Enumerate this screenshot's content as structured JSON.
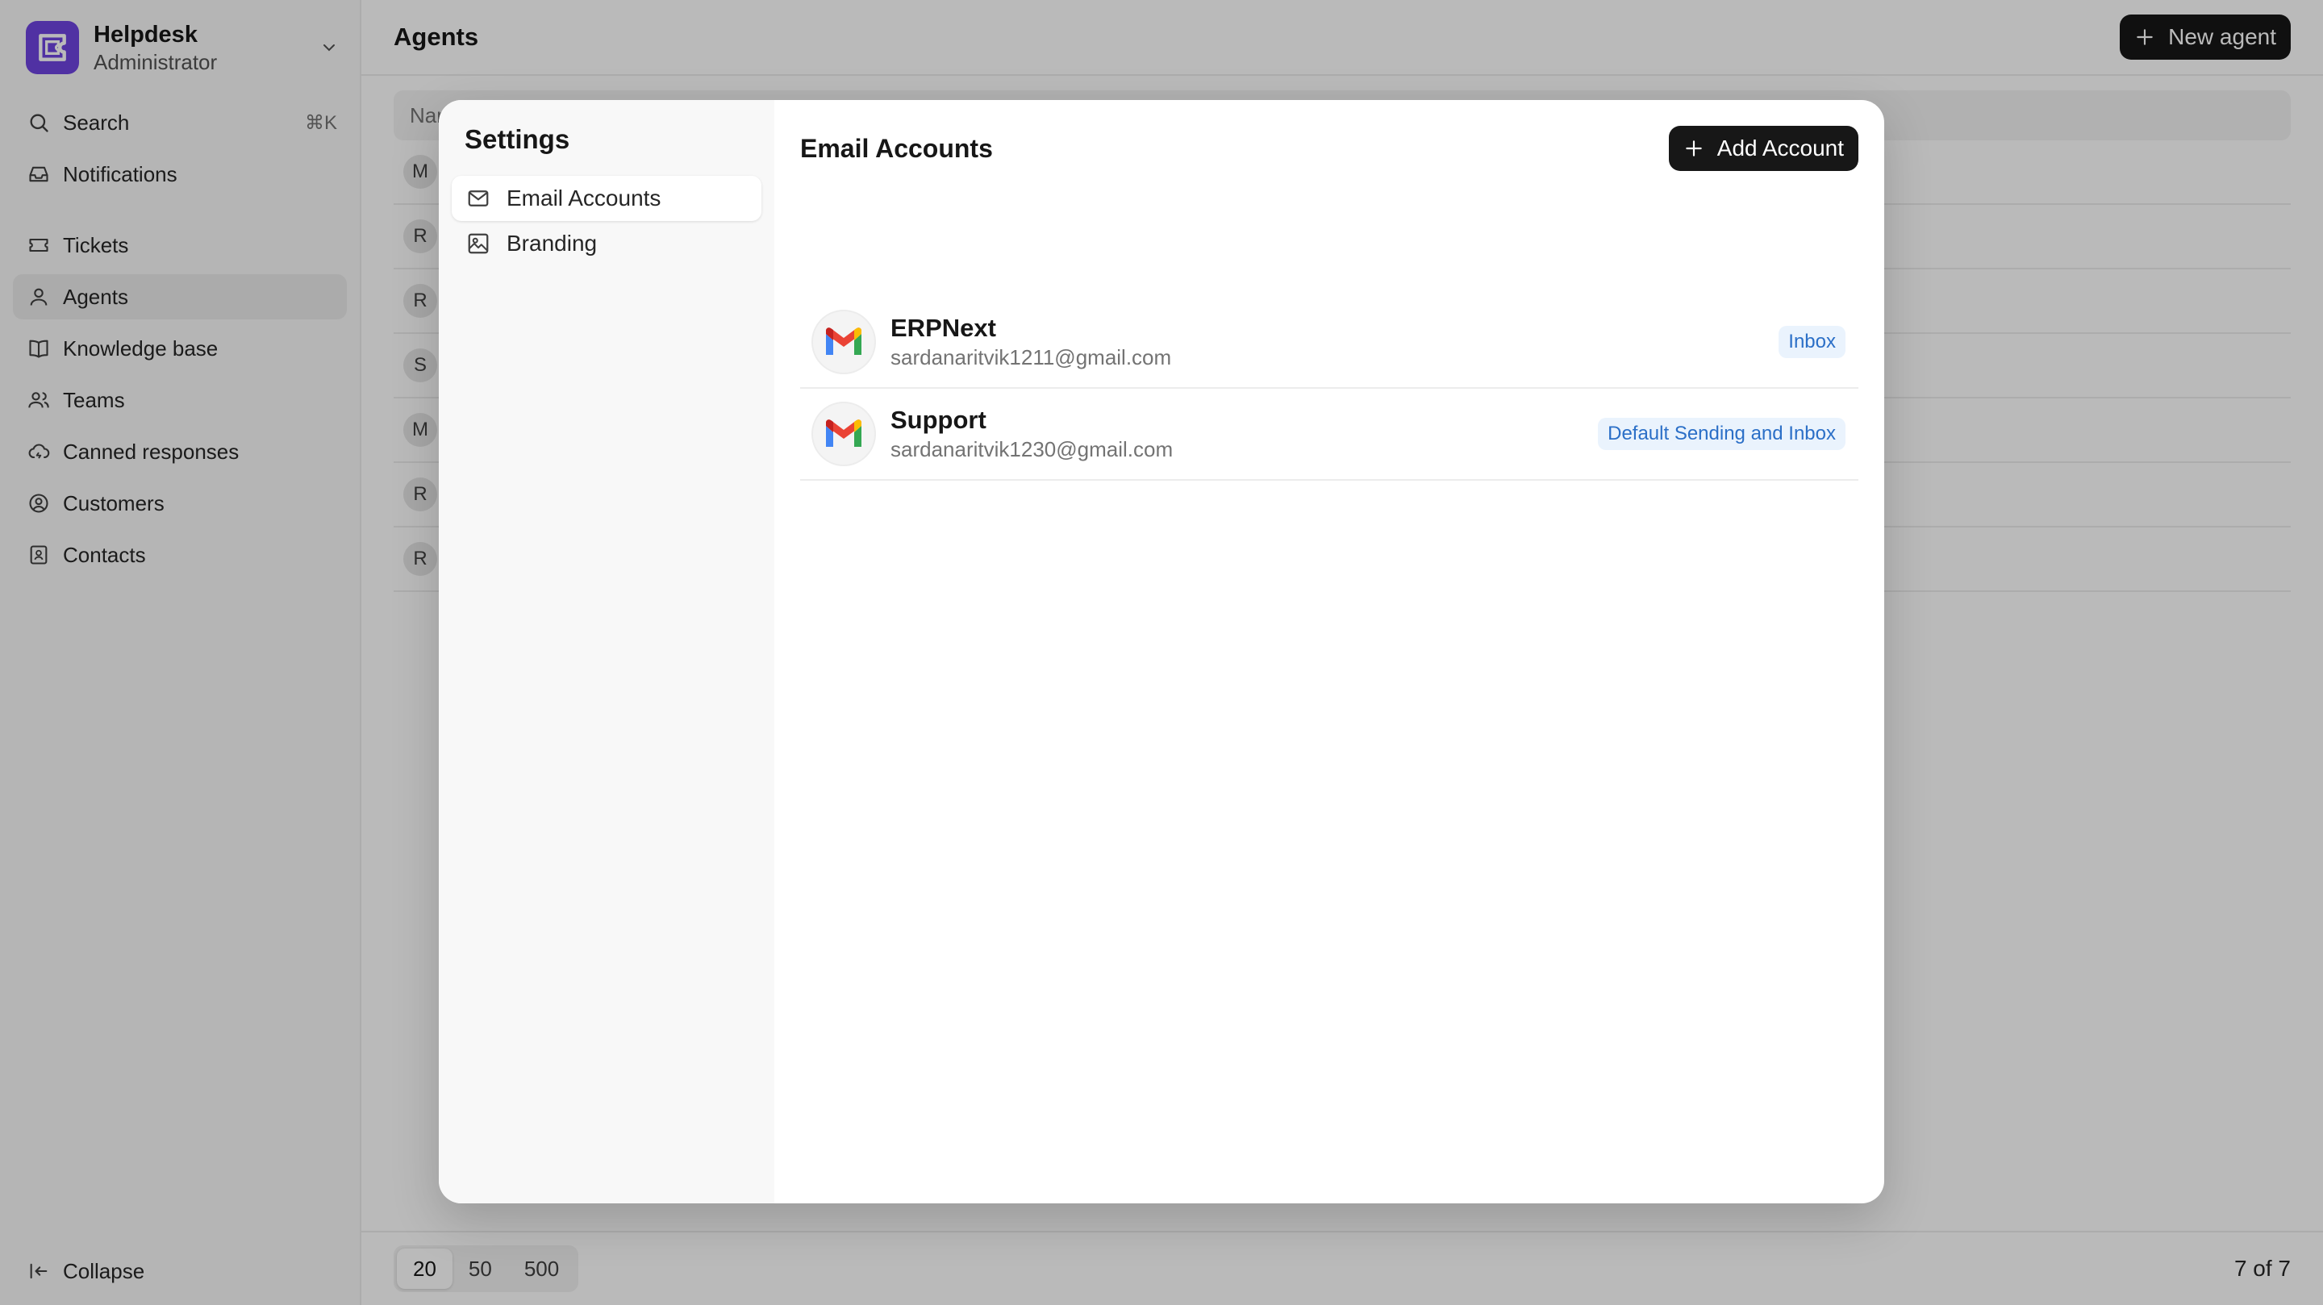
{
  "app": {
    "name": "Helpdesk",
    "role": "Administrator",
    "brand_color": "#6e44e0"
  },
  "sidebar": {
    "search": {
      "label": "Search",
      "shortcut": "⌘K"
    },
    "items": [
      {
        "label": "Notifications",
        "icon": "inbox-icon"
      },
      {
        "label": "Tickets",
        "icon": "ticket-icon"
      },
      {
        "label": "Agents",
        "icon": "user-icon",
        "active": true
      },
      {
        "label": "Knowledge base",
        "icon": "book-icon"
      },
      {
        "label": "Teams",
        "icon": "users-icon"
      },
      {
        "label": "Canned responses",
        "icon": "cloud-icon"
      },
      {
        "label": "Customers",
        "icon": "user-circle-icon"
      },
      {
        "label": "Contacts",
        "icon": "contact-icon"
      }
    ],
    "collapse_label": "Collapse"
  },
  "page": {
    "title": "Agents",
    "new_button": "New agent",
    "list_header_name": "Name",
    "row_initials": [
      "M",
      "R",
      "R",
      "S",
      "M",
      "R",
      "R"
    ]
  },
  "pagination": {
    "options": [
      "20",
      "50",
      "500"
    ],
    "selected": "20",
    "count": "7 of 7"
  },
  "modal": {
    "title": "Settings",
    "nav": [
      {
        "label": "Email Accounts",
        "icon": "mail-icon",
        "active": true
      },
      {
        "label": "Branding",
        "icon": "image-icon"
      }
    ],
    "section_title": "Email Accounts",
    "add_button": "Add Account",
    "accounts": [
      {
        "name": "ERPNext",
        "email": "sardanaritvik1211@gmail.com",
        "badge": "Inbox",
        "icon": "gmail-icon"
      },
      {
        "name": "Support",
        "email": "sardanaritvik1230@gmail.com",
        "badge": "Default Sending and Inbox",
        "icon": "gmail-icon"
      }
    ]
  }
}
